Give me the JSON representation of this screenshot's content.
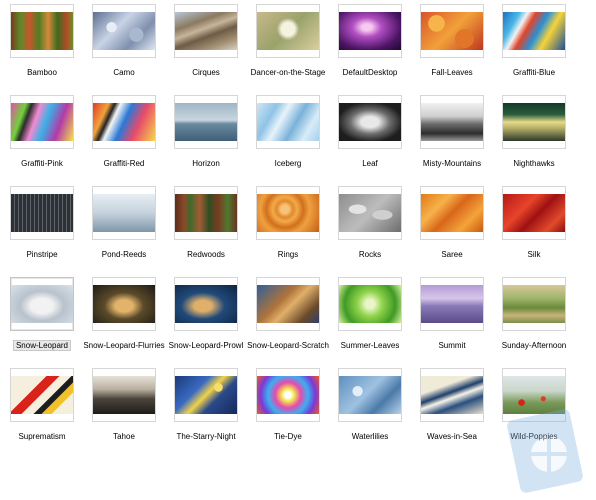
{
  "items": [
    {
      "label": "Bamboo",
      "bg": "linear-gradient(90deg,#7a3c1c 0%,#5c8a2a 15%,#c9552b 30%,#4f7d23 45%,#d48a3a 60%,#3f6a1e 75%,#b34a25 90%,#6b8f2c 100%)"
    },
    {
      "label": "Camo",
      "bg": "radial-gradient(circle at 30% 40%,#e8eef6 0 10%,transparent 11%),radial-gradient(circle at 70% 60%,#aab8cf 0 14%,transparent 15%),linear-gradient(135deg,#5c6f91,#c8d3e6 40%,#7f90ad 70%,#dfe6f1)"
    },
    {
      "label": "Cirques",
      "bg": "linear-gradient(160deg,#b7c8d6 0%,#8b7a62 30%,#c6b59a 45%,#6d5c46 60%,#a39073 80%,#d9d1c2 100%)"
    },
    {
      "label": "Dancer-on-the-Stage",
      "bg": "radial-gradient(circle at 50% 45%,#f5f2e0 0 18%,transparent 30%),linear-gradient(135deg,#c8b98a,#9aa26b 50%,#d9cf9f)"
    },
    {
      "label": "DefaultDesktop",
      "bg": "radial-gradient(ellipse at 45% 40%,#f7c9f0 0 10%,#b24fc2 30%,#4b1464 70%,#1c0a2c 100%)"
    },
    {
      "label": "Fall-Leaves",
      "bg": "radial-gradient(circle at 25% 30%,#f6b44a 0 15%,transparent 16%),radial-gradient(circle at 70% 70%,#e1762a 0 18%,transparent 19%),linear-gradient(135deg,#d9542a,#f2a13a 50%,#c0361f)"
    },
    {
      "label": "Graffiti-Blue",
      "bg": "linear-gradient(120deg,#1f6fbf 0%,#49b7e8 20%,#f2f2f2 30%,#e0442a 40%,#2a8fd6 55%,#f6d33a 70%,#1b4f9a 100%)"
    },
    {
      "label": "Graffiti-Pink",
      "bg": "linear-gradient(110deg,#e64fa8 0%,#6fd23a 20%,#2b2b2b 28%,#f28ad0 40%,#3ab0e6 55%,#b33aa8 75%,#f4e04a 100%)"
    },
    {
      "label": "Graffiti-Red",
      "bg": "linear-gradient(115deg,#e03a2a 0%,#f2a23a 20%,#222 28%,#f5f5f5 35%,#2a79d6 50%,#e84a6a 70%,#f6d74a 100%)"
    },
    {
      "label": "Horizon",
      "bg": "linear-gradient(180deg,#9fb5c6 0%,#c9d6de 45%,#6a8aa0 55%,#3f5f76 100%)"
    },
    {
      "label": "Iceberg",
      "bg": "linear-gradient(120deg,#cfe6f5 0%,#8ec3e6 25%,#e8f3fa 40%,#79b2da 60%,#d8ecf8 80%,#a6cfe9 100%)"
    },
    {
      "label": "Leaf",
      "bg": "radial-gradient(ellipse at 50% 50%,#e8e8e8 0 20%,#6d6d6d 45%,#1d1d1d 75%),linear-gradient(#444,#111)"
    },
    {
      "label": "Misty-Mountains",
      "bg": "linear-gradient(180deg,#f0f0f0 0%,#cfcfcf 35%,#6d6d6d 55%,#2d2d2d 80%,#9a9a9a 100%)"
    },
    {
      "label": "Nighthawks",
      "bg": "linear-gradient(180deg,#123a2a 0%,#2a5c3a 30%,#e6d98a 50%,#b8b36a 65%,#2d3a2a 100%)"
    },
    {
      "label": "Pinstripe",
      "bg": "repeating-linear-gradient(90deg,#2d3035 0 3px,#5d6168 3px 4px)"
    },
    {
      "label": "Pond-Reeds",
      "bg": "linear-gradient(180deg,#e8eef3 0%,#c5d2dd 50%,#7f96aa 100%)"
    },
    {
      "label": "Redwoods",
      "bg": "linear-gradient(90deg,#5b2e1c 0%,#8b4a2a 15%,#3f6b2a 25%,#a35a33 40%,#2e4e21 55%,#7a3b22 70%,#4f7a2e 85%,#6a3520 100%)"
    },
    {
      "label": "Rings",
      "bg": "radial-gradient(circle at 45% 40%,#f7c27a 0 10%,#e28a2a 20%,#f3a94a 30%,#d0701c 45%,#f0a040 60%,#c25f17 100%)"
    },
    {
      "label": "Rocks",
      "bg": "radial-gradient(ellipse at 30% 40%,#e3e3e3 0 14%,transparent 15%),radial-gradient(ellipse at 70% 55%,#cfcfcf 0 16%,transparent 17%),linear-gradient(135deg,#8d8d8d,#bdbdbd 50%,#6d6d6d)"
    },
    {
      "label": "Saree",
      "bg": "linear-gradient(135deg,#e07a18 0%,#f6b24a 30%,#d8661a 50%,#f4a33a 75%,#c9580f 100%)"
    },
    {
      "label": "Silk",
      "bg": "linear-gradient(135deg,#b61818 0%,#e8442a 35%,#9e1212 55%,#e24a2c 80%,#8a0e0e 100%)"
    },
    {
      "label": "Snow-Leopard",
      "bg": "radial-gradient(ellipse at 50% 55%,#f2f2f2 0 25%,#b8c2cc 50%,#d9e2ea 100%)"
    },
    {
      "label": "Snow-Leopard-Flurries",
      "bg": "radial-gradient(ellipse at 50% 55%,#e2b36a 0 20%,#5a4a2a 45%,#1d1a14 100%)"
    },
    {
      "label": "Snow-Leopard-Prowl",
      "bg": "radial-gradient(ellipse at 45% 55%,#e0b06a 0 18%,#214a7a 45%,#0e2442 100%)"
    },
    {
      "label": "Snow-Leopard-Scratch",
      "bg": "linear-gradient(135deg,#2f5f9a 0%,#b0743a 40%,#e0b06a 55%,#6a4a2a 80%,#2f3f6a 100%)"
    },
    {
      "label": "Summer-Leaves",
      "bg": "radial-gradient(circle at 50% 50%,#eaf6c8 0 12%,#8fd24a 35%,#3f9a24 70%,#d8f2a0 100%)"
    },
    {
      "label": "Summit",
      "bg": "linear-gradient(180deg,#b39ad6 0%,#d8c6ea 35%,#8a7bb8 55%,#5a4a8a 100%)"
    },
    {
      "label": "Sunday-Afternoon",
      "bg": "linear-gradient(180deg,#d6c79a 0%,#9fb56a 35%,#6a8a3a 60%,#c9b27a 80%,#7a8f4a 100%)"
    },
    {
      "label": "Suprematism",
      "bg": "linear-gradient(135deg,#f5efe0 0%,#f5efe0 35%,#d8221a 36%,#d8221a 48%,#f5efe0 49%,#f5efe0 60%,#1d1d1d 61%,#1d1d1d 68%,#f2c12a 69%,#f2c12a 78%,#f5efe0 79%)"
    },
    {
      "label": "Tahoe",
      "bg": "linear-gradient(180deg,#e6e1d6 0%,#b9b0a0 35%,#4a443c 60%,#1f1c18 100%)"
    },
    {
      "label": "The-Starry-Night",
      "bg": "radial-gradient(circle at 70% 30%,#f2e06a 0 8%,transparent 9%),linear-gradient(135deg,#1a3a7a 0%,#3a6ac2 35%,#f2d24a 50%,#2a4a8a 65%,#142a5a 100%)"
    },
    {
      "label": "Tie-Dye",
      "bg": "radial-gradient(circle at 50% 50%,#ffffff 0 8%,#f2e24a 18%,#e64ab0 35%,#3ab0f0 55%,#7a3ad6 75%,#f05a2a 100%)"
    },
    {
      "label": "Waterlilies",
      "bg": "radial-gradient(circle at 30% 40%,#e2eef8 0 10%,transparent 11%),linear-gradient(135deg,#5f8fc0,#9fc2e0 45%,#4a7aa8 70%,#b8d2ea)"
    },
    {
      "label": "Waves-in-Sea",
      "bg": "linear-gradient(160deg,#f0ead8 0%,#f0ead8 30%,#1f3f6a 45%,#f7f3e8 55%,#2a4f7e 70%,#e8e1cc 100%)"
    },
    {
      "label": "Wild-Poppies",
      "bg": "radial-gradient(circle at 30% 70%,#d8221a 0 6%,transparent 7%),radial-gradient(circle at 65% 60%,#e03a2a 0 5%,transparent 6%),linear-gradient(180deg,#dfe6ea 0%,#c9d6c8 40%,#7a9a5a 70%,#5f7f3f 100%)"
    }
  ],
  "selected_index": 21
}
